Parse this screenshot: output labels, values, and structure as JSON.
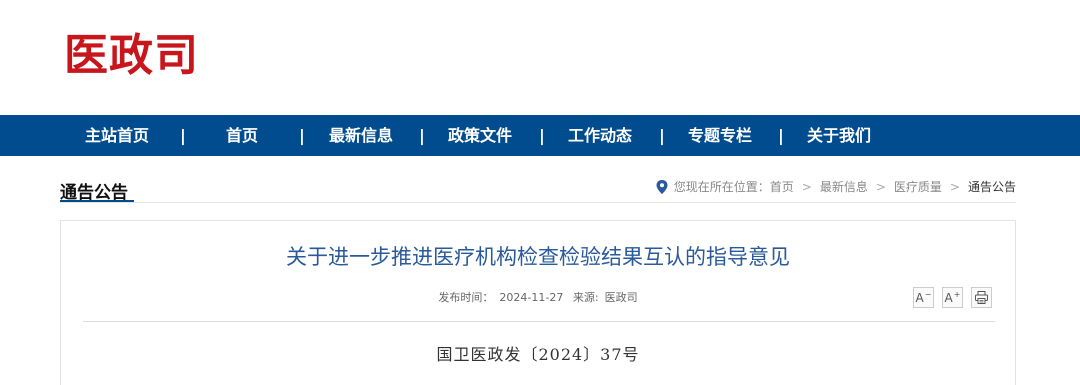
{
  "site": {
    "logo_text": "医政司"
  },
  "nav": {
    "items": [
      {
        "label": "主站首页"
      },
      {
        "label": "首页"
      },
      {
        "label": "最新信息"
      },
      {
        "label": "政策文件"
      },
      {
        "label": "工作动态"
      },
      {
        "label": "专题专栏"
      },
      {
        "label": "关于我们"
      }
    ],
    "separator": "|"
  },
  "section": {
    "title": "通告公告"
  },
  "breadcrumb": {
    "prefix": "您现在所在位置：",
    "items": [
      "首页",
      "最新信息",
      "医疗质量",
      "通告公告"
    ],
    "separator": ">"
  },
  "article": {
    "title": "关于进一步推进医疗机构检查检验结果互认的指导意见",
    "published_label": "发布时间：",
    "published_date": "2024-11-27",
    "source_label": "来源:",
    "source": "医政司",
    "doc_number": "国卫医政发〔2024〕37号"
  },
  "tools": {
    "decrease_font": "A",
    "decrease_sup": "−",
    "increase_font": "A",
    "increase_sup": "+"
  },
  "colors": {
    "brand_red": "#c8161d",
    "nav_blue": "#004c8f",
    "title_blue": "#2a5a9a"
  }
}
